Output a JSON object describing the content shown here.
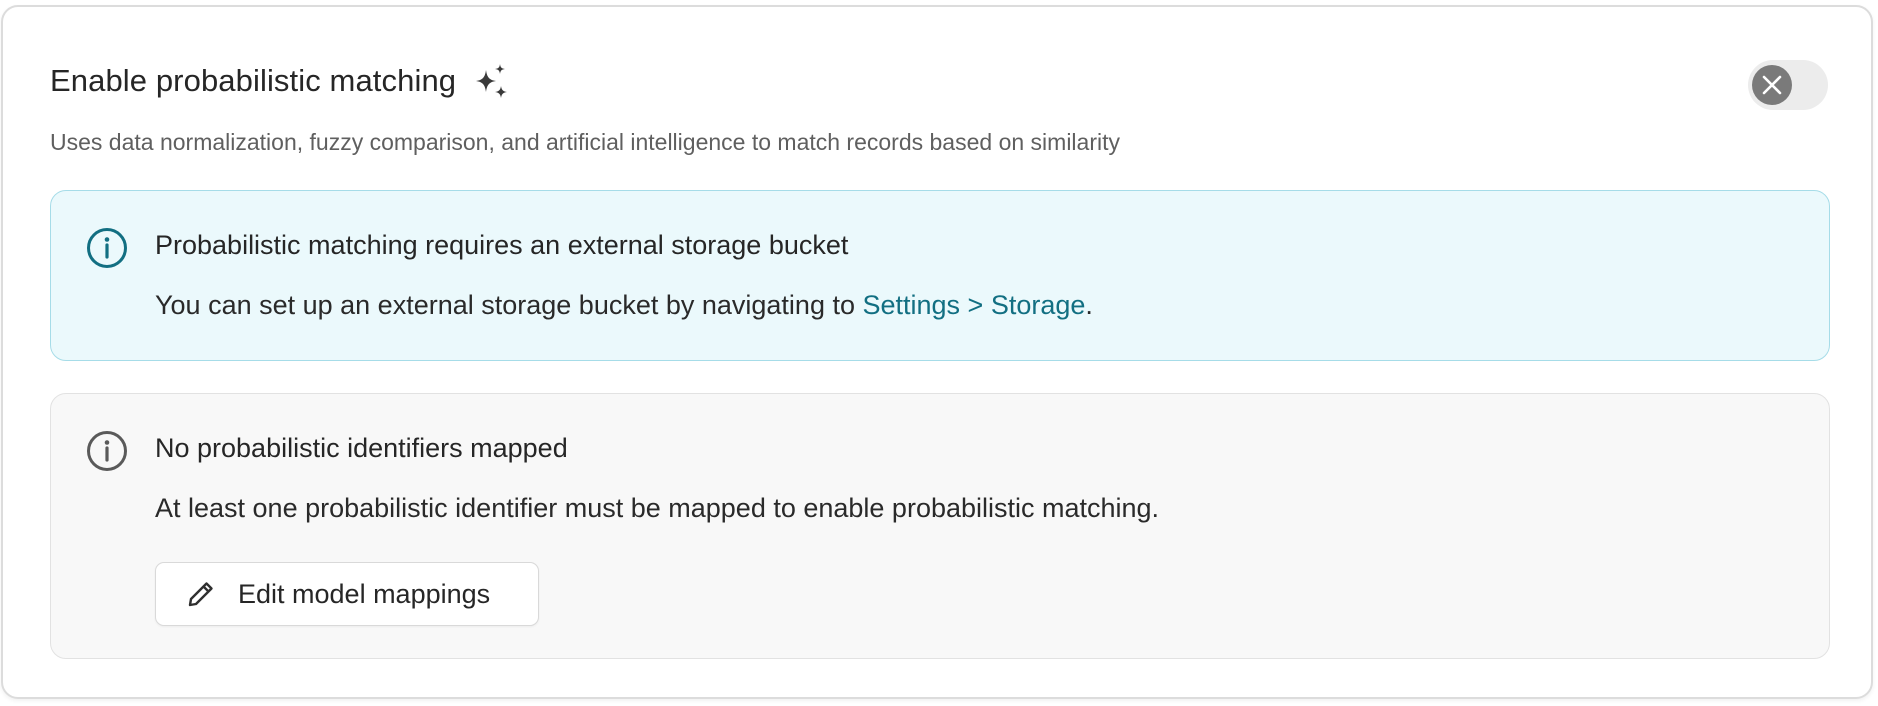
{
  "header": {
    "title": "Enable probabilistic matching",
    "title_icon": "sparkles-icon",
    "subtitle": "Uses data normalization, fuzzy comparison, and artificial intelligence to match records based on similarity",
    "toggle": {
      "state": "off",
      "icon": "close-icon"
    }
  },
  "storage_alert": {
    "icon": "info-icon",
    "title": "Probabilistic matching requires an external storage bucket",
    "body_prefix": "You can set up an external storage bucket by navigating to ",
    "link_text": "Settings > Storage",
    "body_suffix": ".",
    "accent_color": "#126f82"
  },
  "identifiers_alert": {
    "icon": "info-icon",
    "title": "No probabilistic identifiers mapped",
    "body": "At least one probabilistic identifier must be mapped to enable probabilistic matching.",
    "button_label": "Edit model mappings",
    "button_icon": "pencil-icon"
  }
}
